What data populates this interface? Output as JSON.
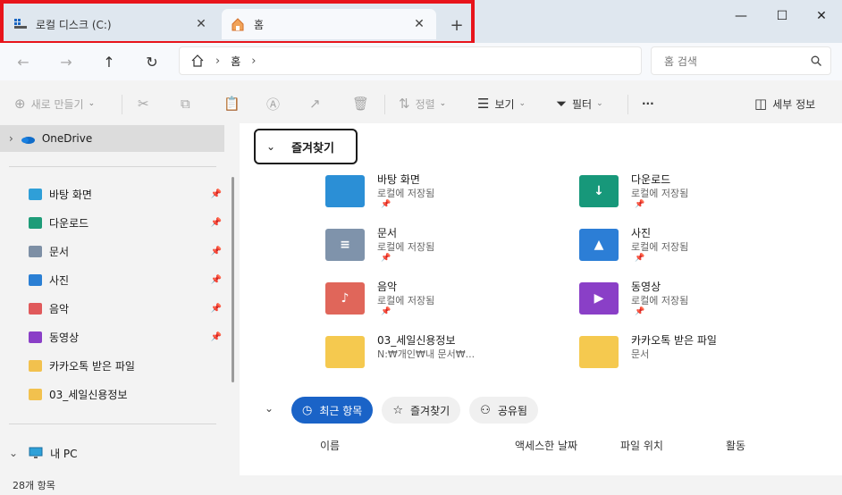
{
  "tabs": [
    {
      "label": "로컬 디스크 (C:)",
      "icon": "drive-icon"
    },
    {
      "label": "홈",
      "icon": "home-icon"
    }
  ],
  "window_controls": {
    "minimize": "—",
    "maximize": "☐",
    "close": "✕"
  },
  "address": {
    "crumbs": [
      "홈"
    ],
    "search_placeholder": "홈 검색"
  },
  "commands": {
    "new": "새로 만들기",
    "sort": "정렬",
    "view": "보기",
    "filter": "필터",
    "details": "세부 정보",
    "more": "···"
  },
  "sidebar": {
    "onedrive": "OneDrive",
    "quick": [
      {
        "label": "바탕 화면",
        "icon": "desktop-icon",
        "color": "#2f9fd8",
        "pinned": true
      },
      {
        "label": "다운로드",
        "icon": "download-icon",
        "color": "#1e9c78",
        "pinned": true
      },
      {
        "label": "문서",
        "icon": "document-icon",
        "color": "#7d8fa5",
        "pinned": true
      },
      {
        "label": "사진",
        "icon": "picture-icon",
        "color": "#2a7fd4",
        "pinned": true
      },
      {
        "label": "음악",
        "icon": "music-icon",
        "color": "#e0595b",
        "pinned": true
      },
      {
        "label": "동영상",
        "icon": "video-icon",
        "color": "#8a3fc7",
        "pinned": true
      },
      {
        "label": "카카오톡 받은 파일",
        "icon": "folder-icon",
        "color": "#f2c14e",
        "pinned": false
      },
      {
        "label": "03_세일신용정보",
        "icon": "folder-icon",
        "color": "#f2c14e",
        "pinned": false
      }
    ],
    "pc": "내 PC"
  },
  "favorites": {
    "title": "즐겨찾기",
    "items": [
      {
        "name": "바탕 화면",
        "sub": "로컬에 저장됨",
        "color": "#2b8fd6",
        "glyph": "",
        "pinned": true
      },
      {
        "name": "다운로드",
        "sub": "로컬에 저장됨",
        "color": "#17987a",
        "glyph": "↓",
        "pinned": true
      },
      {
        "name": "문서",
        "sub": "로컬에 저장됨",
        "color": "#7f93ab",
        "glyph": "≡",
        "pinned": true
      },
      {
        "name": "사진",
        "sub": "로컬에 저장됨",
        "color": "#2c7ed6",
        "glyph": "▲",
        "pinned": true
      },
      {
        "name": "음악",
        "sub": "로컬에 저장됨",
        "color": "#e0665a",
        "glyph": "♪",
        "pinned": true
      },
      {
        "name": "동영상",
        "sub": "로컬에 저장됨",
        "color": "#8a3fc7",
        "glyph": "▶",
        "pinned": true
      },
      {
        "name": "03_세일신용정보",
        "sub": "N:₩개인₩내 문서₩...",
        "color": "#f5c94f",
        "glyph": "",
        "pinned": false
      },
      {
        "name": "카카오톡 받은 파일",
        "sub": "문서",
        "color": "#f5c94f",
        "glyph": "",
        "pinned": false
      }
    ]
  },
  "recent_tabs": [
    "최근 항목",
    "즐겨찾기",
    "공유됨"
  ],
  "columns": [
    "이름",
    "액세스한 날짜",
    "파일 위치",
    "활동"
  ],
  "status": "28개 항목"
}
